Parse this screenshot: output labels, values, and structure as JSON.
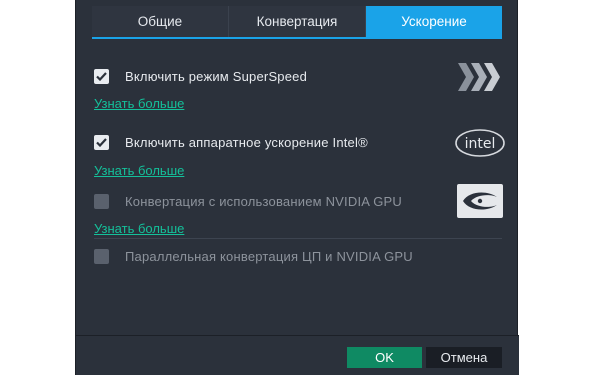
{
  "tabs": [
    {
      "label": "Общие",
      "active": false
    },
    {
      "label": "Конвертация",
      "active": false
    },
    {
      "label": "Ускорение",
      "active": true
    }
  ],
  "options": [
    {
      "label": "Включить режим SuperSpeed",
      "checked": true,
      "enabled": true,
      "icon": "superspeed-chevrons-icon"
    },
    {
      "label": "Включить аппаратное ускорение Intel®",
      "checked": true,
      "enabled": true,
      "icon": "intel-logo-icon"
    },
    {
      "label": "Конвертация с использованием NVIDIA GPU",
      "checked": false,
      "enabled": false,
      "icon": "nvidia-logo-icon"
    },
    {
      "label": "Параллельная конвертация ЦП и NVIDIA GPU",
      "checked": false,
      "enabled": false
    }
  ],
  "links": {
    "learn_more": "Узнать больше"
  },
  "intel_logo_text": "intel",
  "buttons": {
    "ok": "OK",
    "cancel": "Отмена"
  },
  "colors": {
    "accent": "#1aa3e8",
    "link": "#14c09a",
    "ok_button": "#0f8a63",
    "background": "#2b313b"
  }
}
